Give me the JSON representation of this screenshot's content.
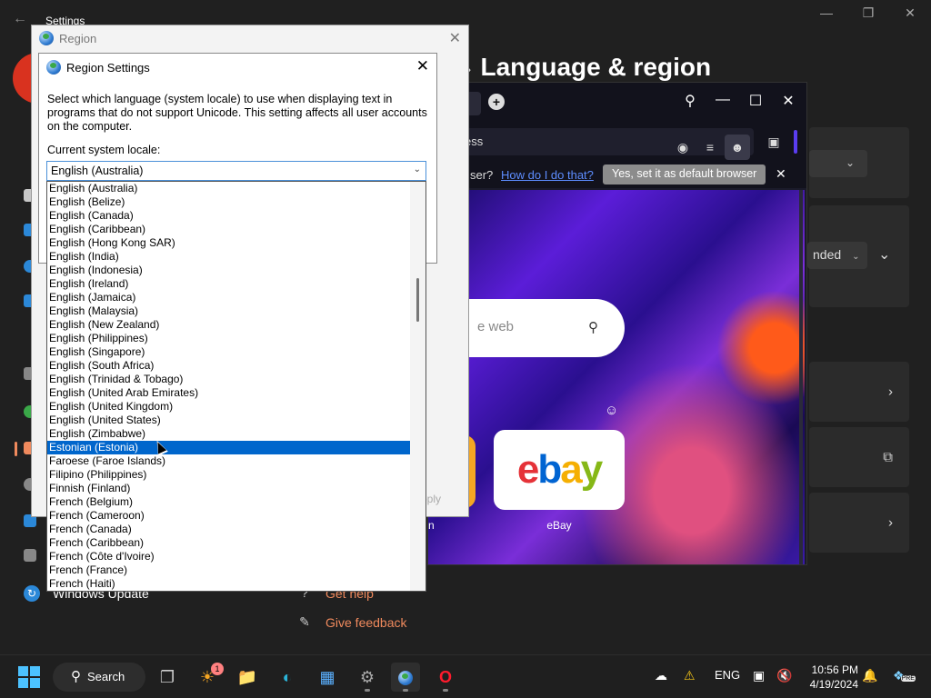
{
  "settings": {
    "app_title": "Settings",
    "breadcrumb_prev": "ge",
    "page_title": "Language & region",
    "nav_windows_update": "Windows Update",
    "get_help": "Get help",
    "give_feedback": "Give feedback",
    "lang_dropdown_value": "nded"
  },
  "browser": {
    "address_text": "ess",
    "notif_question": "ser?",
    "notif_how": "How do I do that?",
    "notif_set_default": "Yes, set it as default browser",
    "search_placeholder": "e web",
    "speed_dial": [
      {
        "label": "eBay",
        "logo": "ebay"
      },
      {
        "label": "n",
        "logo": ""
      }
    ]
  },
  "region_dialog": {
    "title": "Region",
    "apply_label": "Apply"
  },
  "region_settings": {
    "title": "Region Settings",
    "description": "Select which language (system locale) to use when displaying text in programs that do not support Unicode. This setting affects all user accounts on the computer.",
    "current_label": "Current system locale:",
    "current_value": "English (Australia)",
    "options": [
      "English (Australia)",
      "English (Belize)",
      "English (Canada)",
      "English (Caribbean)",
      "English (Hong Kong SAR)",
      "English (India)",
      "English (Indonesia)",
      "English (Ireland)",
      "English (Jamaica)",
      "English (Malaysia)",
      "English (New Zealand)",
      "English (Philippines)",
      "English (Singapore)",
      "English (South Africa)",
      "English (Trinidad & Tobago)",
      "English (United Arab Emirates)",
      "English (United Kingdom)",
      "English (United States)",
      "English (Zimbabwe)",
      "Estonian (Estonia)",
      "Faroese (Faroe Islands)",
      "Filipino (Philippines)",
      "Finnish (Finland)",
      "French (Belgium)",
      "French (Cameroon)",
      "French (Canada)",
      "French (Caribbean)",
      "French (Côte d'Ivoire)",
      "French (France)",
      "French (Haiti)"
    ],
    "highlighted_index": 19
  },
  "taskbar": {
    "search_label": "Search",
    "weather_badge": "1",
    "language": "ENG",
    "time": "10:56 PM",
    "date": "4/19/2024",
    "copilot_badge": "PRE"
  },
  "colors": {
    "accent": "#0066cc",
    "link": "#5d8dff",
    "feedback_link": "#f08a5d"
  }
}
